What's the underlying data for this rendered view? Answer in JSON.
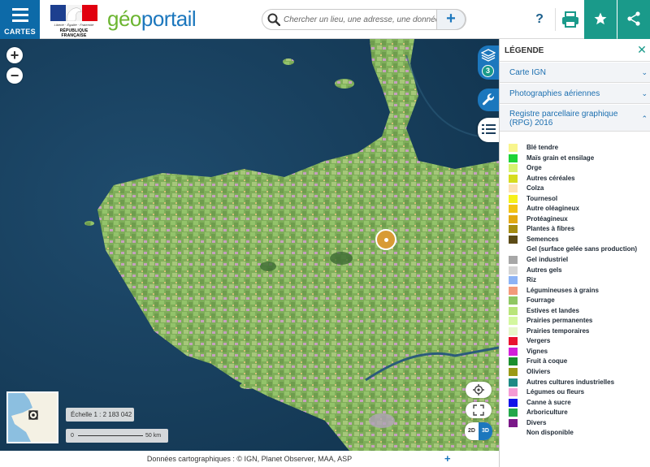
{
  "header": {
    "menu_label": "CARTES",
    "republic_motto": "Liberté · Égalité · Fraternité",
    "republic_name": "RÉPUBLIQUE FRANÇAISE",
    "brand_geo": "géo",
    "brand_portail": "portail",
    "search_placeholder": "Chercher un lieu, une adresse, une donnée",
    "search_add": "+",
    "help": "?"
  },
  "map": {
    "zoom_in": "+",
    "zoom_out": "−",
    "layers_count": "3",
    "scale_text": "Échelle 1 : 2 183 042",
    "scale_min": "0",
    "scale_max": "50 km",
    "view_2d": "2D",
    "view_3d": "3D"
  },
  "footer": {
    "credits": "Données cartographiques : © IGN, Planet Observer, MAA, ASP",
    "more": "+"
  },
  "panel": {
    "title": "LÉGENDE",
    "layers": [
      {
        "label": "Carte IGN"
      },
      {
        "label": "Photographies aériennes"
      },
      {
        "label": "Registre parcellaire graphique (RPG) 2016"
      }
    ],
    "legend": [
      {
        "label": "Blé tendre",
        "color": "#f8f58d"
      },
      {
        "label": "Maïs grain et ensilage",
        "color": "#1ed337"
      },
      {
        "label": "Orge",
        "color": "#d7f26f"
      },
      {
        "label": "Autres céréales",
        "color": "#d6dc1f"
      },
      {
        "label": "Colza",
        "color": "#fde1b3"
      },
      {
        "label": "Tournesol",
        "color": "#f6f01a"
      },
      {
        "label": "Autre oléagineux",
        "color": "#f2c315"
      },
      {
        "label": "Protéagineux",
        "color": "#e2a912"
      },
      {
        "label": "Plantes à fibres",
        "color": "#a68d12"
      },
      {
        "label": "Semences",
        "color": "#5c4b16"
      },
      {
        "label": "Gel (surface gelée sans production)",
        "color": "#ffffff"
      },
      {
        "label": "Gel industriel",
        "color": "#a7a7a7"
      },
      {
        "label": "Autres gels",
        "color": "#d4d4d4"
      },
      {
        "label": "Riz",
        "color": "#8db3f5"
      },
      {
        "label": "Légumineuses à grains",
        "color": "#f39a7a"
      },
      {
        "label": "Fourrage",
        "color": "#8fc762"
      },
      {
        "label": "Estives et landes",
        "color": "#b9e57a"
      },
      {
        "label": "Prairies permanentes",
        "color": "#d4f79f"
      },
      {
        "label": "Prairies temporaires",
        "color": "#e6f7c9"
      },
      {
        "label": "Vergers",
        "color": "#e8122f"
      },
      {
        "label": "Vignes",
        "color": "#d21fd8"
      },
      {
        "label": "Fruit à coque",
        "color": "#1a8f2e"
      },
      {
        "label": "Oliviers",
        "color": "#9a9a16"
      },
      {
        "label": "Autres cultures industrielles",
        "color": "#1e8a84"
      },
      {
        "label": "Légumes ou fleurs",
        "color": "#f59ad4"
      },
      {
        "label": "Canne à sucre",
        "color": "#1313e8"
      },
      {
        "label": "Arboriculture",
        "color": "#23a84a"
      },
      {
        "label": "Divers",
        "color": "#7a1888"
      },
      {
        "label": "Non disponible",
        "color": "#ffffff"
      }
    ]
  }
}
